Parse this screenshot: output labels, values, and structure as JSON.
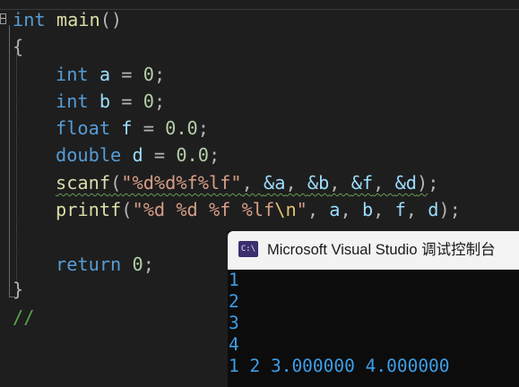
{
  "editor": {
    "lines": {
      "l1": {
        "kw": "int",
        "fn": "main",
        "paren": "()"
      },
      "l2": {
        "brace": "{"
      },
      "l3": {
        "kw": "int",
        "var": "a",
        "eq": " = ",
        "num": "0",
        "end": ";"
      },
      "l4": {
        "kw": "int",
        "var": "b",
        "eq": " = ",
        "num": "0",
        "end": ";"
      },
      "l5": {
        "kw": "float",
        "var": "f",
        "eq": " = ",
        "num": "0.0",
        "end": ";"
      },
      "l6": {
        "kw": "double",
        "var": "d",
        "eq": " = ",
        "num": "0.0",
        "end": ";"
      },
      "l7": {
        "fn": "scanf",
        "open": "(",
        "str": "\"%d%d%f%lf\"",
        "c1": ", ",
        "a1": "&a",
        "c2": ", ",
        "a2": "&b",
        "c3": ", ",
        "a3": "&f",
        "c4": ", ",
        "a4": "&d",
        "close": ")",
        "end": ";"
      },
      "l8": {
        "fn": "printf",
        "open": "(",
        "str1": "\"%d %d %f %lf",
        "esc": "\\n",
        "str2": "\"",
        "c1": ", ",
        "a1": "a",
        "c2": ", ",
        "a2": "b",
        "c3": ", ",
        "a3": "f",
        "c4": ", ",
        "a4": "d",
        "close": ")",
        "end": ";"
      },
      "l10": {
        "kw": "return",
        "num": "0",
        "end": ";"
      },
      "l11": {
        "brace": "}"
      },
      "l12": {
        "comment": "//"
      }
    }
  },
  "console": {
    "icon_text": "C:\\",
    "title": "Microsoft Visual Studio 调试控制台",
    "output": [
      "1",
      "2",
      "3",
      "4",
      "1 2 3.000000 4.000000"
    ]
  },
  "colors": {
    "keyword": "#569cd6",
    "function": "#dcdcaa",
    "variable": "#9cdcfe",
    "number": "#b5cea8",
    "string": "#d69d85",
    "console_text": "#3d9ee8"
  }
}
